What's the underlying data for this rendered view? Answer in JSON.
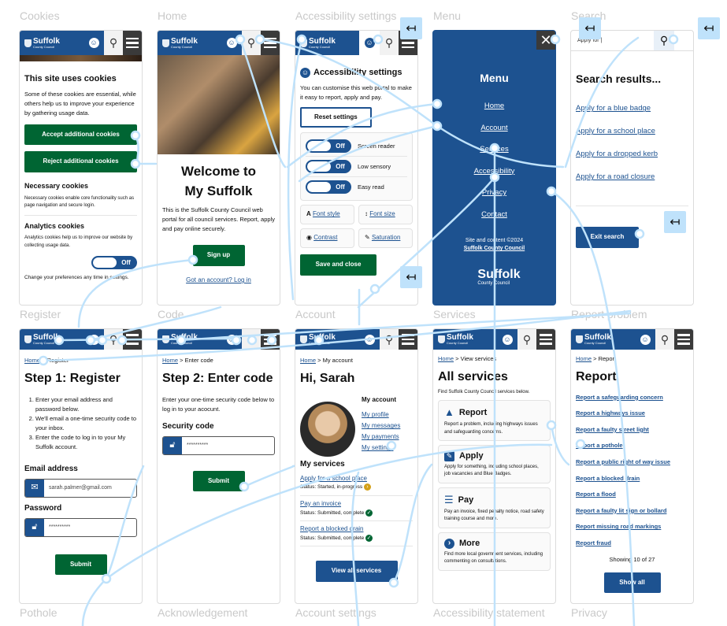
{
  "brand": {
    "name": "Suffolk",
    "sub": "County Council",
    "primary": "#1d5290",
    "green": "#006533",
    "flow_line": "#bfe2fb"
  },
  "frames": {
    "cookies": {
      "label": "Cookies",
      "title": "This site uses cookies",
      "intro": "Some of these cookies are essential, while others help us to improve your experience by gathering usage data.",
      "accept": "Accept additional cookies",
      "reject": "Reject additional cookies",
      "necessary_title": "Necessary cookies",
      "necessary_text": "Necessary cookies enable core functionality such as page navigation and secure login.",
      "analytics_title": "Analytics cookies",
      "analytics_text": "Analytics cookies help us to improve our website by collecting usage data.",
      "toggle": "Off",
      "footer": "Change your preferences any time in settings."
    },
    "home": {
      "label": "Home",
      "title_line1": "Welcome to",
      "title_line2": "My Suffolk",
      "text": "This is the Suffolk County Council web portal for all council services. Report, apply and pay online securely.",
      "signup": "Sign up",
      "login": "Got an account? Log in"
    },
    "accessibility": {
      "label": "Accessibility settings",
      "title": "Accessibility settings",
      "text": "You can customise this web portal to make it easy to report, apply and pay.",
      "reset": "Reset settings",
      "toggles": [
        {
          "label": "Screen reader",
          "state": "Off"
        },
        {
          "label": "Low sensory",
          "state": "Off"
        },
        {
          "label": "Easy read",
          "state": "Off"
        }
      ],
      "options": [
        "Font style",
        "Font size",
        "Contrast",
        "Saturation"
      ],
      "save": "Save and close"
    },
    "menu": {
      "label": "Menu",
      "title": "Menu",
      "items": [
        "Home",
        "Account",
        "Services",
        "Accessibility",
        "Privacy",
        "Contact"
      ],
      "copyright": "Site and content ©2024",
      "owner": "Suffolk County Council"
    },
    "search": {
      "label": "Search",
      "query": "Apply for |",
      "title": "Search results...",
      "results": [
        "Apply for a blue badge",
        "Apply for a school place",
        "Apply for a dropped kerb",
        "Apply for a road closure"
      ],
      "exit": "Exit search"
    },
    "register": {
      "label": "Register",
      "crumb_home": "Home",
      "crumb_current": "Register",
      "title": "Step 1: Register",
      "steps": [
        "Enter your email address and password below.",
        "We'll email a one-time security code to your inbox.",
        "Enter the code to log in to your My Suffolk account."
      ],
      "email_label": "Email address",
      "email_value": "sarah.palmer@gmail.com",
      "password_label": "Password",
      "password_value": "**********",
      "submit": "Submit"
    },
    "code": {
      "label": "Code",
      "crumb_home": "Home",
      "crumb_current": "Enter code",
      "title": "Step 2: Enter code",
      "text": "Enter your one-time security code below to log in to your acocunt.",
      "field_label": "Security code",
      "field_value": "**********",
      "submit": "Submit"
    },
    "account": {
      "label": "Account",
      "crumb_home": "Home",
      "crumb_current": "My account",
      "title": "Hi, Sarah",
      "links_title": "My account",
      "links": [
        "My profile",
        "My messages",
        "My payments",
        "My settings"
      ],
      "services_title": "My services",
      "services": [
        {
          "name": "Apply for a school place",
          "status": "Status: Started, in-progress",
          "state": "in-progress"
        },
        {
          "name": "Pay an invoice",
          "status": "Status: Submitted, complete",
          "state": "complete"
        },
        {
          "name": "Report a blocked drain",
          "status": "Status: Submitted, complete",
          "state": "complete"
        }
      ],
      "view_all": "View all services"
    },
    "services": {
      "label": "Services",
      "crumb_home": "Home",
      "crumb_current": "View services",
      "title": "All services",
      "intro": "Find Suffolk County Council services below.",
      "cards": [
        {
          "icon": "warning-icon",
          "glyph": "!",
          "title": "Report",
          "text": "Report a problem, including highways issues and safeguarding concerns."
        },
        {
          "icon": "pencil-icon",
          "glyph": "✎",
          "title": "Apply",
          "text": "Apply for something, including school places, job vacancies and Blue Badges."
        },
        {
          "icon": "coins-icon",
          "glyph": "≡",
          "title": "Pay",
          "text": "Pay an invoice, fixed penalty notice, road safety training course and more."
        },
        {
          "icon": "chevron-right-icon",
          "glyph": "›",
          "title": "More",
          "text": "Find more local government services, including commenting on consultations."
        }
      ]
    },
    "report": {
      "label": "Report problem",
      "crumb_home": "Home",
      "crumb_current": "Report",
      "title": "Report",
      "links": [
        "Report a safeguarding concern",
        "Report a highways issue",
        "Report a faulty street light",
        "Report a pothole",
        "Report a public right of way issue",
        "Report a blocked drain",
        "Report a flood",
        "Report a faulty lit sign or bollard",
        "Report missing road markings",
        "Report fraud"
      ],
      "showing": "Showing 10 of 27",
      "show_all": "Show all"
    }
  },
  "bottom_labels": [
    "Pothole",
    "Acknowledgement",
    "Account settings",
    "Accessibility statement",
    "Privacy"
  ],
  "back_glyph": "↤"
}
